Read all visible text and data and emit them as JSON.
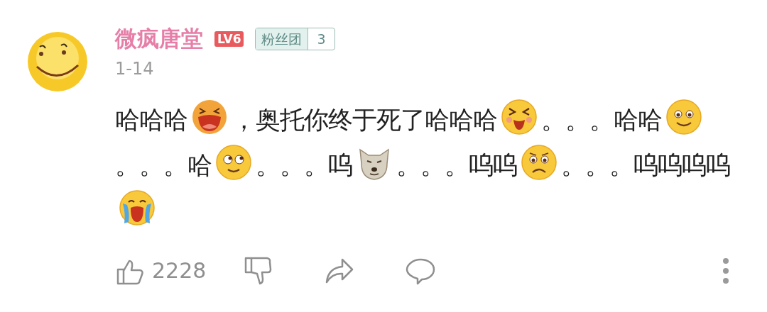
{
  "user": {
    "name": "微疯唐堂",
    "level": "LV6",
    "fan_badge": {
      "label": "粉丝团",
      "count": "3"
    }
  },
  "date": "1-14",
  "content": [
    {
      "kind": "text",
      "text": "哈哈哈"
    },
    {
      "kind": "laugh"
    },
    {
      "kind": "text",
      "text": "，奥托你终于死了哈哈哈"
    },
    {
      "kind": "squint"
    },
    {
      "kind": "text",
      "text": "。。。哈哈"
    },
    {
      "kind": "smile"
    },
    {
      "kind": "text",
      "text": "。。。哈"
    },
    {
      "kind": "roll"
    },
    {
      "kind": "text",
      "text": "。。。呜"
    },
    {
      "kind": "dog"
    },
    {
      "kind": "text",
      "text": "。。。呜呜"
    },
    {
      "kind": "worried"
    },
    {
      "kind": "text",
      "text": "。。。呜"
    },
    {
      "kind": "text",
      "text": "呜呜呜"
    },
    {
      "kind": "cry"
    }
  ],
  "actions": {
    "like_count": "2228"
  }
}
